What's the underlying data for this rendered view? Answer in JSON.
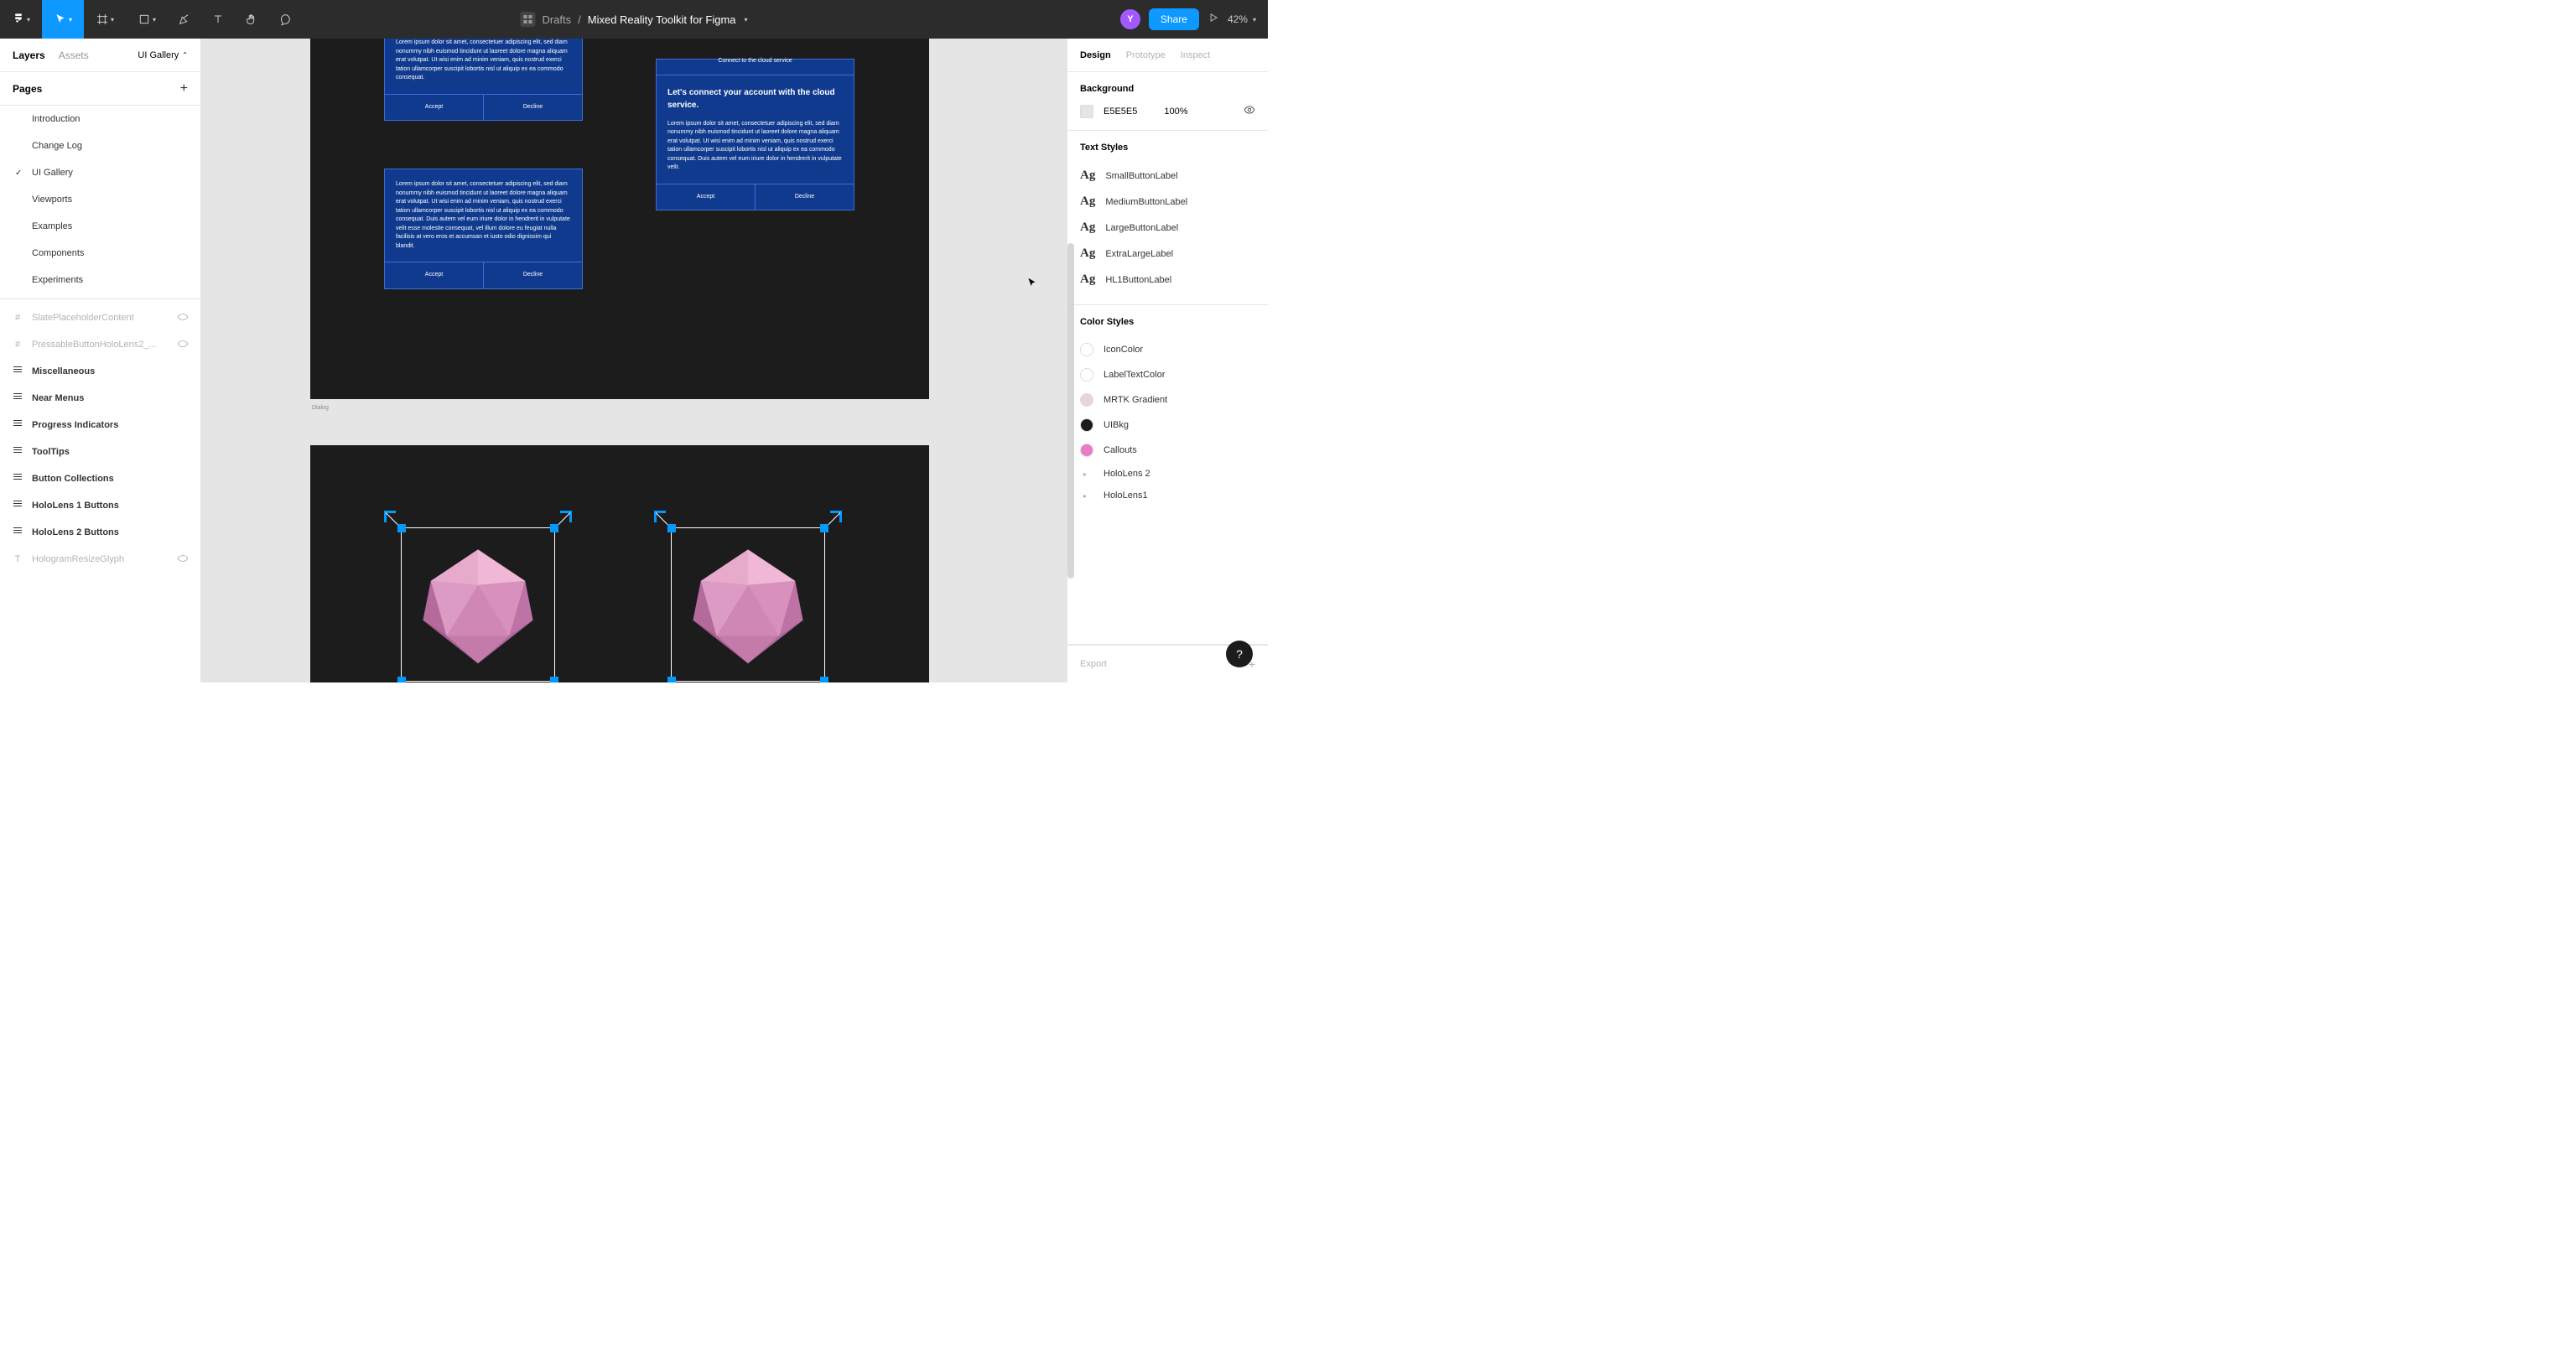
{
  "toolbar": {
    "drafts": "Drafts",
    "title": "Mixed Reality Toolkit for Figma",
    "avatar": "Y",
    "share": "Share",
    "zoom": "42%"
  },
  "left": {
    "tab_layers": "Layers",
    "tab_assets": "Assets",
    "page_selector": "UI Gallery",
    "pages_header": "Pages",
    "pages": [
      {
        "label": "Introduction",
        "selected": false
      },
      {
        "label": "Change Log",
        "selected": false
      },
      {
        "label": "UI Gallery",
        "selected": true
      },
      {
        "label": "Viewports",
        "selected": false
      },
      {
        "label": "Examples",
        "selected": false
      },
      {
        "label": "Components",
        "selected": false
      },
      {
        "label": "Experiments",
        "selected": false
      }
    ],
    "layers": [
      {
        "icon": "#",
        "label": "SlatePlaceholderContent",
        "dim": true,
        "eye": true
      },
      {
        "icon": "#",
        "label": "PressableButtonHoloLens2_...",
        "dim": true,
        "eye": true
      },
      {
        "icon": "frame",
        "label": "Miscellaneous",
        "bold": true
      },
      {
        "icon": "frame",
        "label": "Near Menus",
        "bold": true
      },
      {
        "icon": "frame",
        "label": "Progress Indicators",
        "bold": true
      },
      {
        "icon": "frame",
        "label": "ToolTips",
        "bold": true
      },
      {
        "icon": "frame",
        "label": "Button Collections",
        "bold": true
      },
      {
        "icon": "frame",
        "label": "HoloLens 1 Buttons",
        "bold": true
      },
      {
        "icon": "frame",
        "label": "HoloLens 2 Buttons",
        "bold": true
      },
      {
        "icon": "T",
        "label": "HologramResizeGlyph",
        "dim": true,
        "eye": true
      }
    ]
  },
  "right": {
    "tab_design": "Design",
    "tab_prototype": "Prototype",
    "tab_inspect": "Inspect",
    "bg_header": "Background",
    "bg_hex": "E5E5E5",
    "bg_opacity": "100%",
    "text_styles_header": "Text Styles",
    "text_styles": [
      "SmallButtonLabel",
      "MediumButtonLabel",
      "LargeButtonLabel",
      "ExtraLargeLabel",
      "HL1ButtonLabel"
    ],
    "color_styles_header": "Color Styles",
    "color_styles": [
      {
        "label": "IconColor",
        "color": "#ffffff"
      },
      {
        "label": "LabelTextColor",
        "color": "#ffffff"
      },
      {
        "label": "MRTK Gradient",
        "color": "#e7d4de"
      },
      {
        "label": "UIBkg",
        "color": "#1c1c1c"
      },
      {
        "label": "Callouts",
        "color": "#ea7cc7"
      }
    ],
    "color_groups": [
      "HoloLens 2",
      "HoloLens1"
    ],
    "export": "Export"
  },
  "canvas": {
    "frame1_label": "Dialog",
    "lorem_short": "Lorem ipsum dolor sit amet, consectetuer adipiscing elit, sed diam nonummy nibh euismod tincidunt ut laoreet dolore magna aliquam erat volutpat. Ut wisi enim ad minim veniam, quis nostrud exerci tation ullamcorper suscipit lobortis nisl ut aliquip ex ea commodo consequat.",
    "lorem_long": "Lorem ipsum dolor sit amet, consectetuer adipiscing elit, sed diam nonummy nibh euismod tincidunt ut laoreet dolore magna aliquam erat volutpat. Ut wisi enim ad minim veniam, quis nostrud exerci tation ullamcorper suscipit lobortis nisl ut aliquip ex ea commodo consequat. Duis autem vel eum iriure dolor in hendrerit in vulputate velit esse molestie consequat, vel illum dolore eu feugiat nulla facilisis at vero eros et accumsan et iusto odio dignissim qui blandit.",
    "lorem_med": "Lorem ipsum dolor sit amet, consectetuer adipiscing elit, sed diam nonummy nibh euismod tincidunt ut laoreet dolore magna aliquam erat volutpat. Ut wisi enim ad minim veniam, quis nostrud exerci tation ullamcorper suscipit lobortis nisl ut aliquip ex ea commodo consequat. Duis autem vel eum iriure dolor in hendrerit in vulputate velit.",
    "accept": "Accept",
    "decline": "Decline",
    "card3_header": "Connect to the cloud service",
    "card3_title": "Let's connect your account with the cloud service."
  }
}
